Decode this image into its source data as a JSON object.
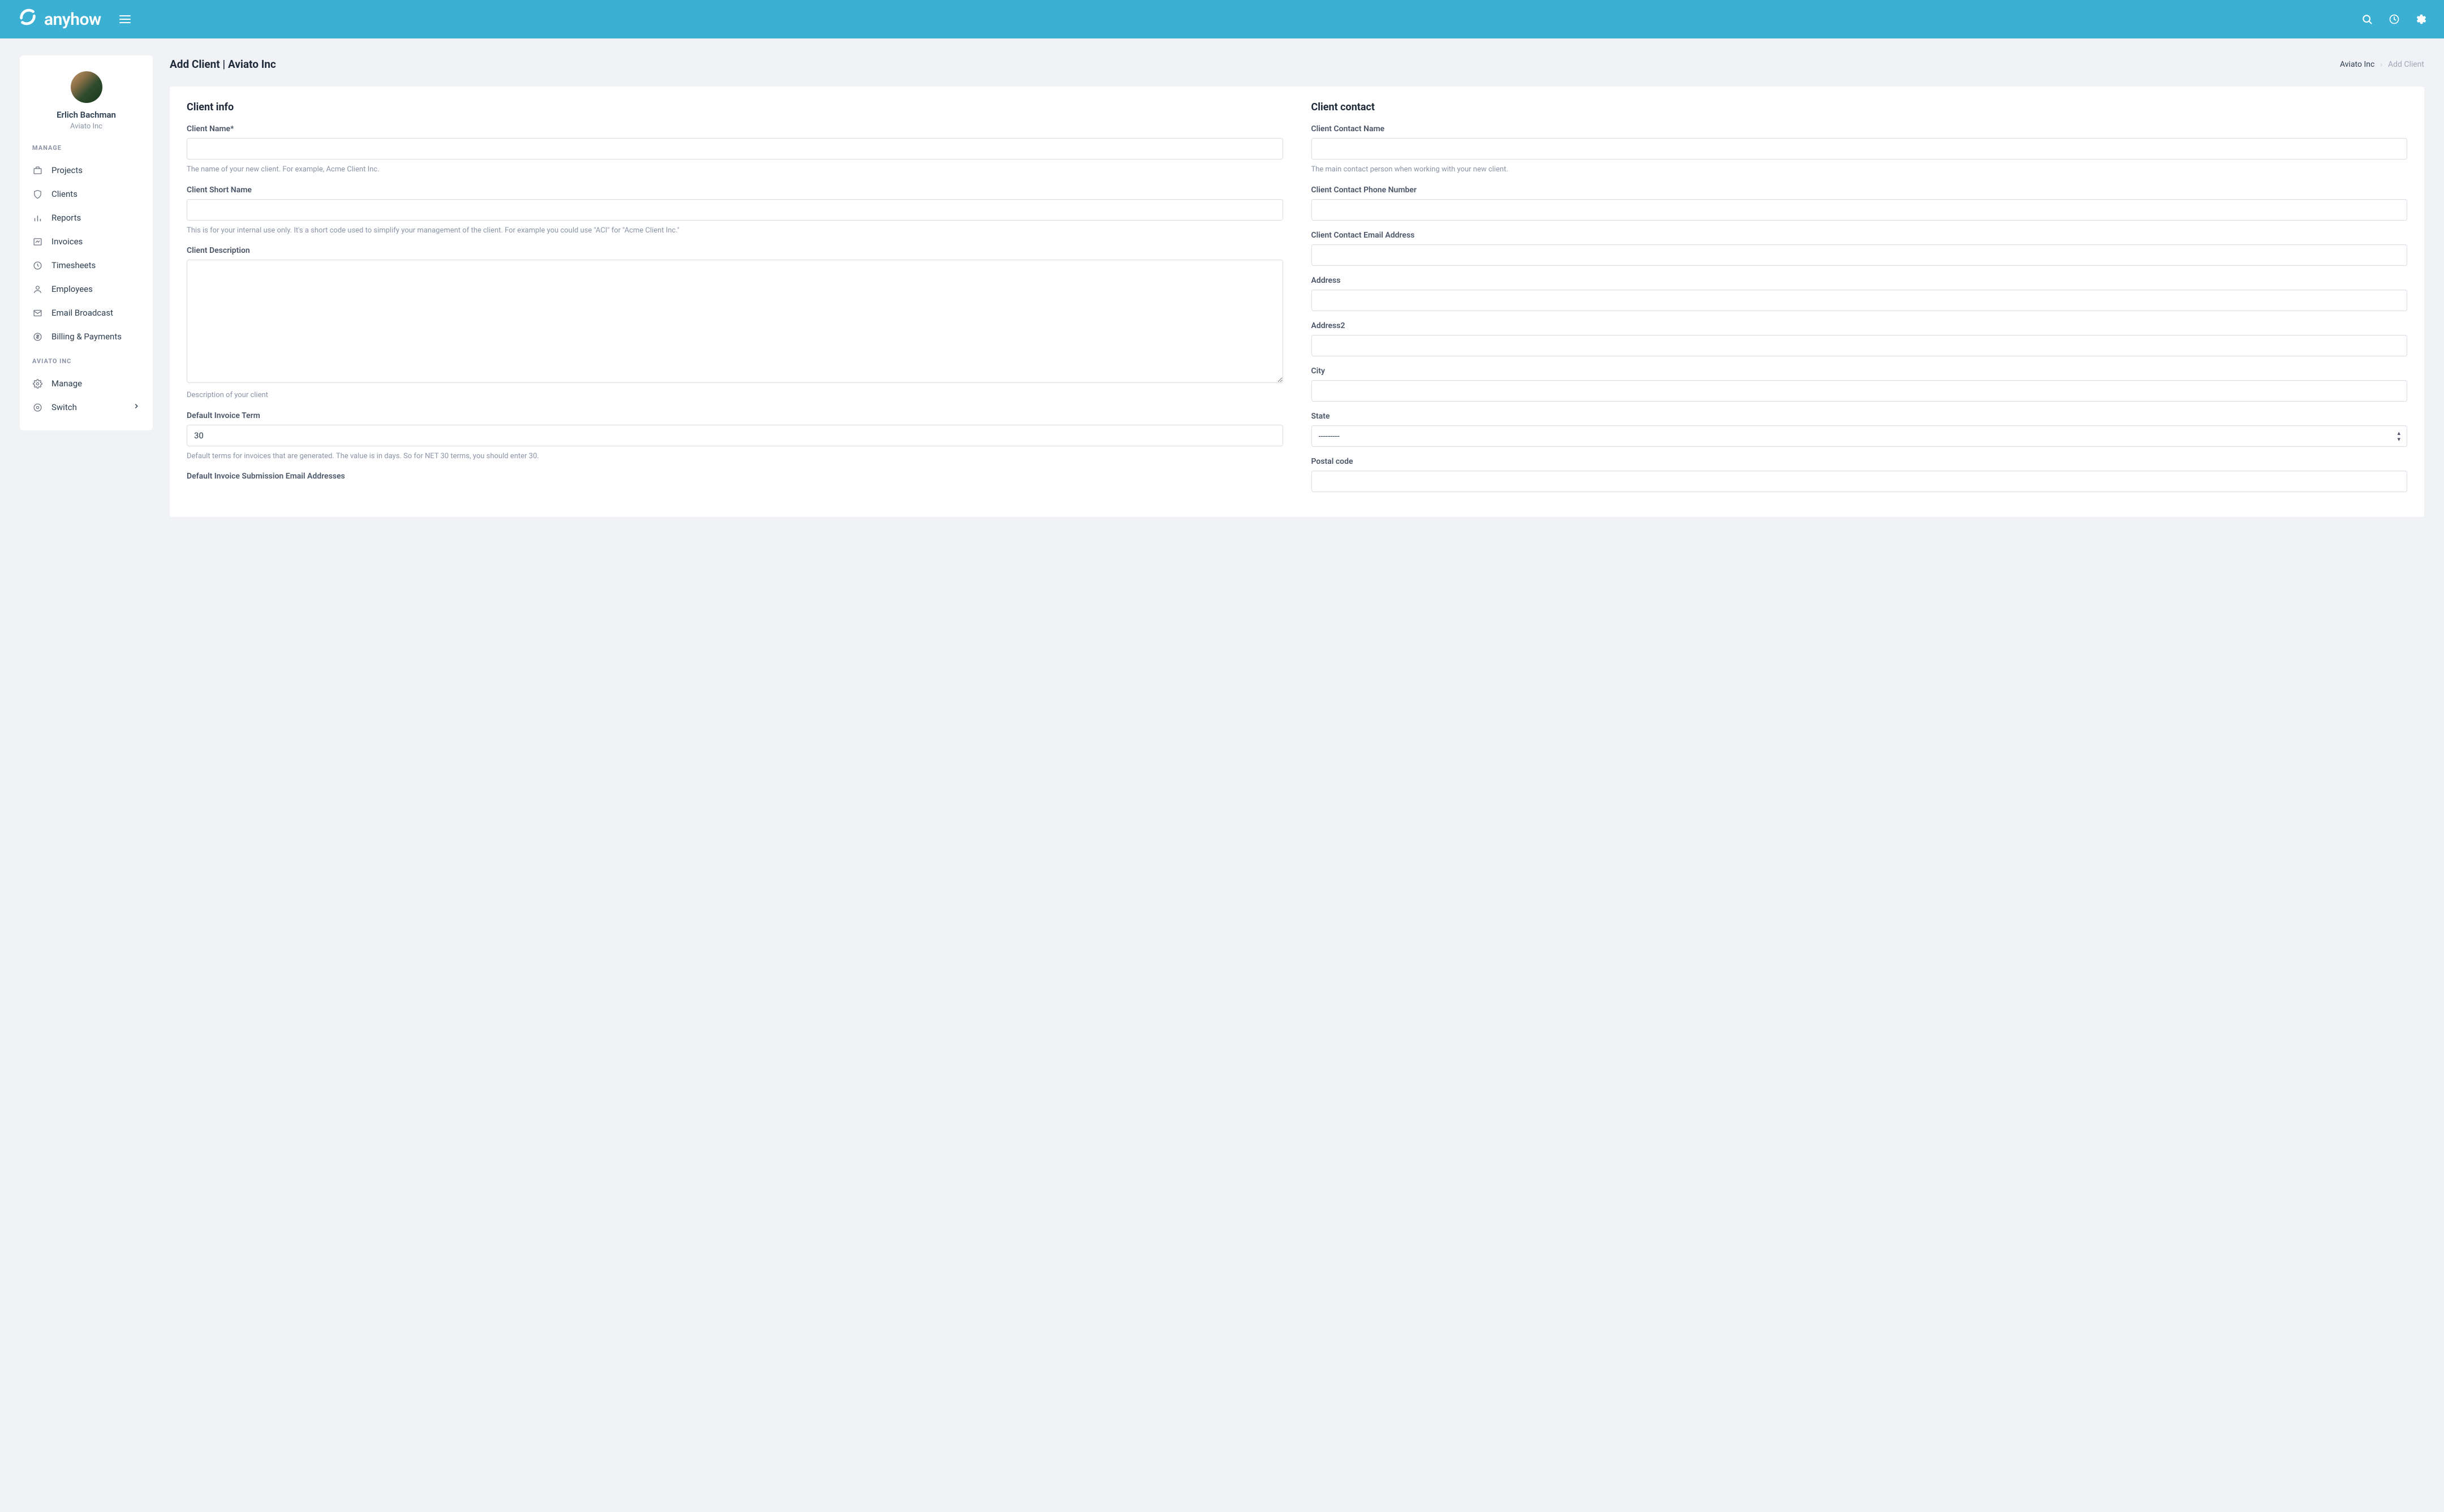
{
  "brand": "anyhow",
  "user": {
    "name": "Erlich Bachman",
    "org": "Aviato Inc"
  },
  "nav": {
    "manage_heading": "MANAGE",
    "org_heading": "AVIATO INC",
    "items": [
      {
        "label": "Projects"
      },
      {
        "label": "Clients"
      },
      {
        "label": "Reports"
      },
      {
        "label": "Invoices"
      },
      {
        "label": "Timesheets"
      },
      {
        "label": "Employees"
      },
      {
        "label": "Email Broadcast"
      },
      {
        "label": "Billing & Payments"
      }
    ],
    "org_items": [
      {
        "label": "Manage"
      },
      {
        "label": "Switch"
      }
    ]
  },
  "page": {
    "title": "Add Client | Aviato Inc",
    "breadcrumb": {
      "parent": "Aviato Inc",
      "current": "Add Client"
    }
  },
  "form": {
    "left": {
      "title": "Client info",
      "client_name": {
        "label": "Client Name*",
        "help": "The name of your new client. For example, Acme Client Inc."
      },
      "client_short_name": {
        "label": "Client Short Name",
        "help": "This is for your internal use only. It's a short code used to simplify your management of the client. For example you could use \"ACI\" for \"Acme Client Inc.\""
      },
      "client_description": {
        "label": "Client Description",
        "help": "Description of your client"
      },
      "default_invoice_term": {
        "label": "Default Invoice Term",
        "value": "30",
        "help": "Default terms for invoices that are generated. The value is in days. So for NET 30 terms, you should enter 30."
      },
      "default_invoice_emails": {
        "label": "Default Invoice Submission Email Addresses"
      }
    },
    "right": {
      "title": "Client contact",
      "contact_name": {
        "label": "Client Contact Name",
        "help": "The main contact person when working with your new client."
      },
      "contact_phone": {
        "label": "Client Contact Phone Number"
      },
      "contact_email": {
        "label": "Client Contact Email Address"
      },
      "address": {
        "label": "Address"
      },
      "address2": {
        "label": "Address2"
      },
      "city": {
        "label": "City"
      },
      "state": {
        "label": "State",
        "placeholder": "---------"
      },
      "postal_code": {
        "label": "Postal code"
      }
    }
  }
}
